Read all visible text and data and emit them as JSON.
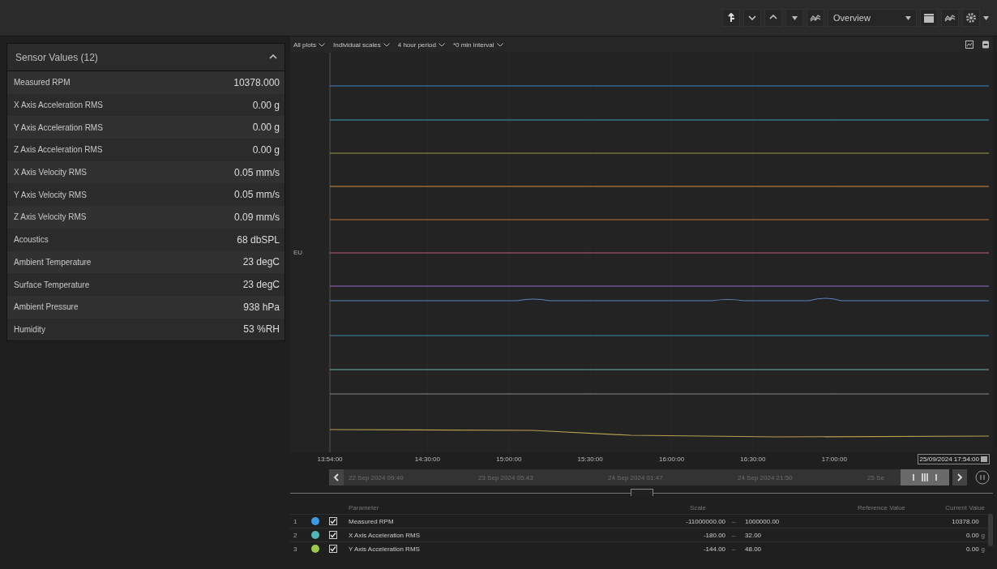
{
  "toolbar": {
    "view": "Overview"
  },
  "sensor_panel": {
    "title": "Sensor Values (12)",
    "expanded": true,
    "rows": [
      {
        "name": "Measured RPM",
        "value": "10378.000"
      },
      {
        "name": "X Axis Acceleration RMS",
        "value": "0.00 g"
      },
      {
        "name": "Y Axis Acceleration RMS",
        "value": "0.00 g"
      },
      {
        "name": "Z Axis Acceleration RMS",
        "value": "0.00 g"
      },
      {
        "name": "X Axis Velocity RMS",
        "value": "0.05 mm/s"
      },
      {
        "name": "Y Axis Velocity RMS",
        "value": "0.05 mm/s"
      },
      {
        "name": "Z Axis Velocity RMS",
        "value": "0.09 mm/s"
      },
      {
        "name": "Acoustics",
        "value": "68 dbSPL"
      },
      {
        "name": "Ambient Temperature",
        "value": "23 degC"
      },
      {
        "name": "Surface Temperature",
        "value": "23 degC"
      },
      {
        "name": "Ambient Pressure",
        "value": "938 hPa"
      },
      {
        "name": "Humidity",
        "value": "53 %RH"
      }
    ]
  },
  "chart": {
    "filters": [
      "All plots",
      "Individual scales",
      "4 hour period",
      "*0 min interval"
    ],
    "y_label": "EU",
    "x_ticks": [
      "13:54:00",
      "14:30:00",
      "15:00:00",
      "15:30:00",
      "16:00:00",
      "16:30:00",
      "17:00:00"
    ],
    "end_time": "25/09/2024 17:54:00",
    "navigator_dates": [
      "22 Sep 2024 09:40",
      "23 Sep 2024 05:43",
      "24 Sep 2024 01:47",
      "24 Sep 2024 21:50",
      "25 Se"
    ]
  },
  "table": {
    "columns": [
      "Parameter",
      "Scale",
      "Reference Value",
      "Current Value"
    ],
    "rows": [
      {
        "index": "1",
        "color": "#3d9be6",
        "checked": true,
        "name": "Measured RPM",
        "scale_min": "-11000000.00",
        "scale_separator": "–",
        "scale_max": "1000000.00",
        "current": "10378.00"
      },
      {
        "index": "2",
        "color": "#4fb8b4",
        "checked": true,
        "name": "X Axis Acceleration RMS",
        "scale_min": "-180.00",
        "scale_separator": "–",
        "scale_max": "32.00",
        "current": "0.00",
        "unit": "g"
      },
      {
        "index": "3",
        "color": "#9cc94a",
        "checked": true,
        "name": "Y Axis Acceleration RMS",
        "scale_min": "-144.00",
        "scale_separator": "–",
        "scale_max": "48.00",
        "current": "0.00",
        "unit": "g"
      }
    ]
  }
}
